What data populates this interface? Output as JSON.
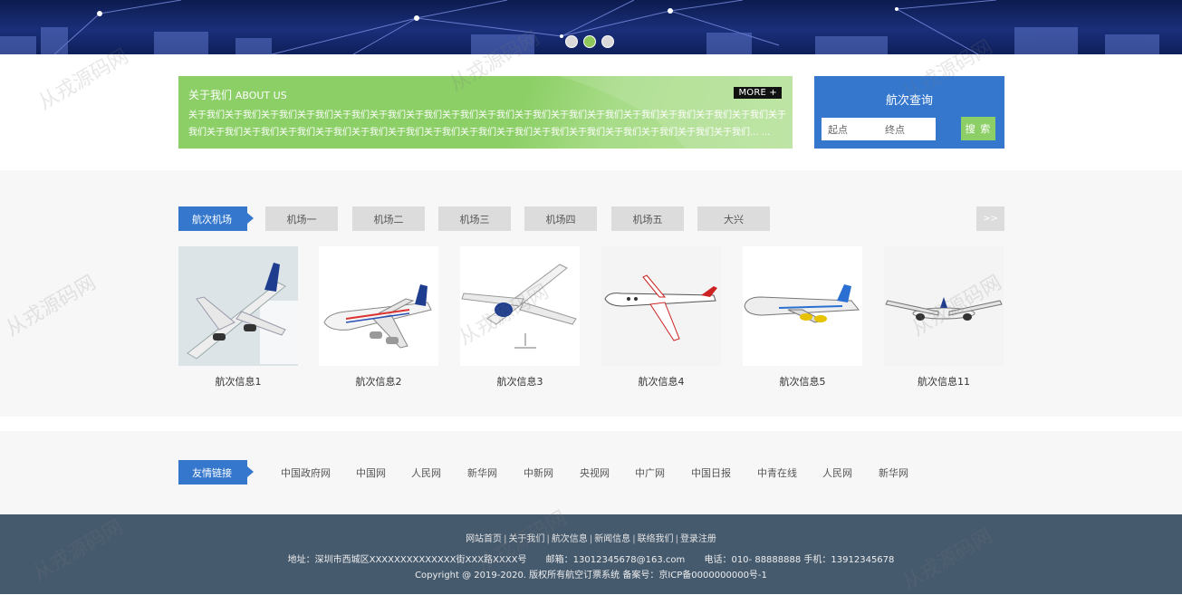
{
  "banner": {
    "dots": 3,
    "active_dot": 1
  },
  "about": {
    "title": "关于我们",
    "title_en": "ABOUT US",
    "more": "MORE +",
    "text": "关于我们关于我们关于我们关于我们关于我们关于我们关于我们关于我们关于我们关于我们关于我们关于我们关于我们关于我们关于我们关于我们关于我们关于我们关于我们关于我们关于我们关于我们关于我们关于我们关于我们关于我们关于我们关于我们关于我们关于我们关于我们关于我们... ..."
  },
  "query": {
    "title": "航次查询",
    "from_placeholder": "起点",
    "to_placeholder": "终点",
    "button": "搜 索"
  },
  "airports": {
    "label": "航次机场",
    "tabs": [
      "机场一",
      "机场二",
      "机场三",
      "机场四",
      "机场五",
      "大兴"
    ],
    "next": ">>"
  },
  "flights": [
    {
      "name": "航次信息1"
    },
    {
      "name": "航次信息2"
    },
    {
      "name": "航次信息3"
    },
    {
      "name": "航次信息4"
    },
    {
      "name": "航次信息5"
    },
    {
      "name": "航次信息11"
    }
  ],
  "links": {
    "label": "友情链接",
    "items": [
      "中国政府网",
      "中国网",
      "人民网",
      "新华网",
      "中新网",
      "央视网",
      "中广网",
      "中国日报",
      "中青在线",
      "人民网",
      "新华网"
    ]
  },
  "footer": {
    "nav": [
      "网站首页",
      "关于我们",
      "航次信息",
      "新闻信息",
      "联络我们",
      "登录注册"
    ],
    "address": "地址：深圳市西城区XXXXXXXXXXXXXX街XXX路XXXX号",
    "email": "邮箱：13012345678@163.com",
    "phone": "电话：010- 88888888 手机：13912345678",
    "copyright": "Copyright @ 2019-2020. 版权所有航空订票系统  备案号：京ICP备0000000000号-1"
  },
  "watermark": "从戎源码网"
}
